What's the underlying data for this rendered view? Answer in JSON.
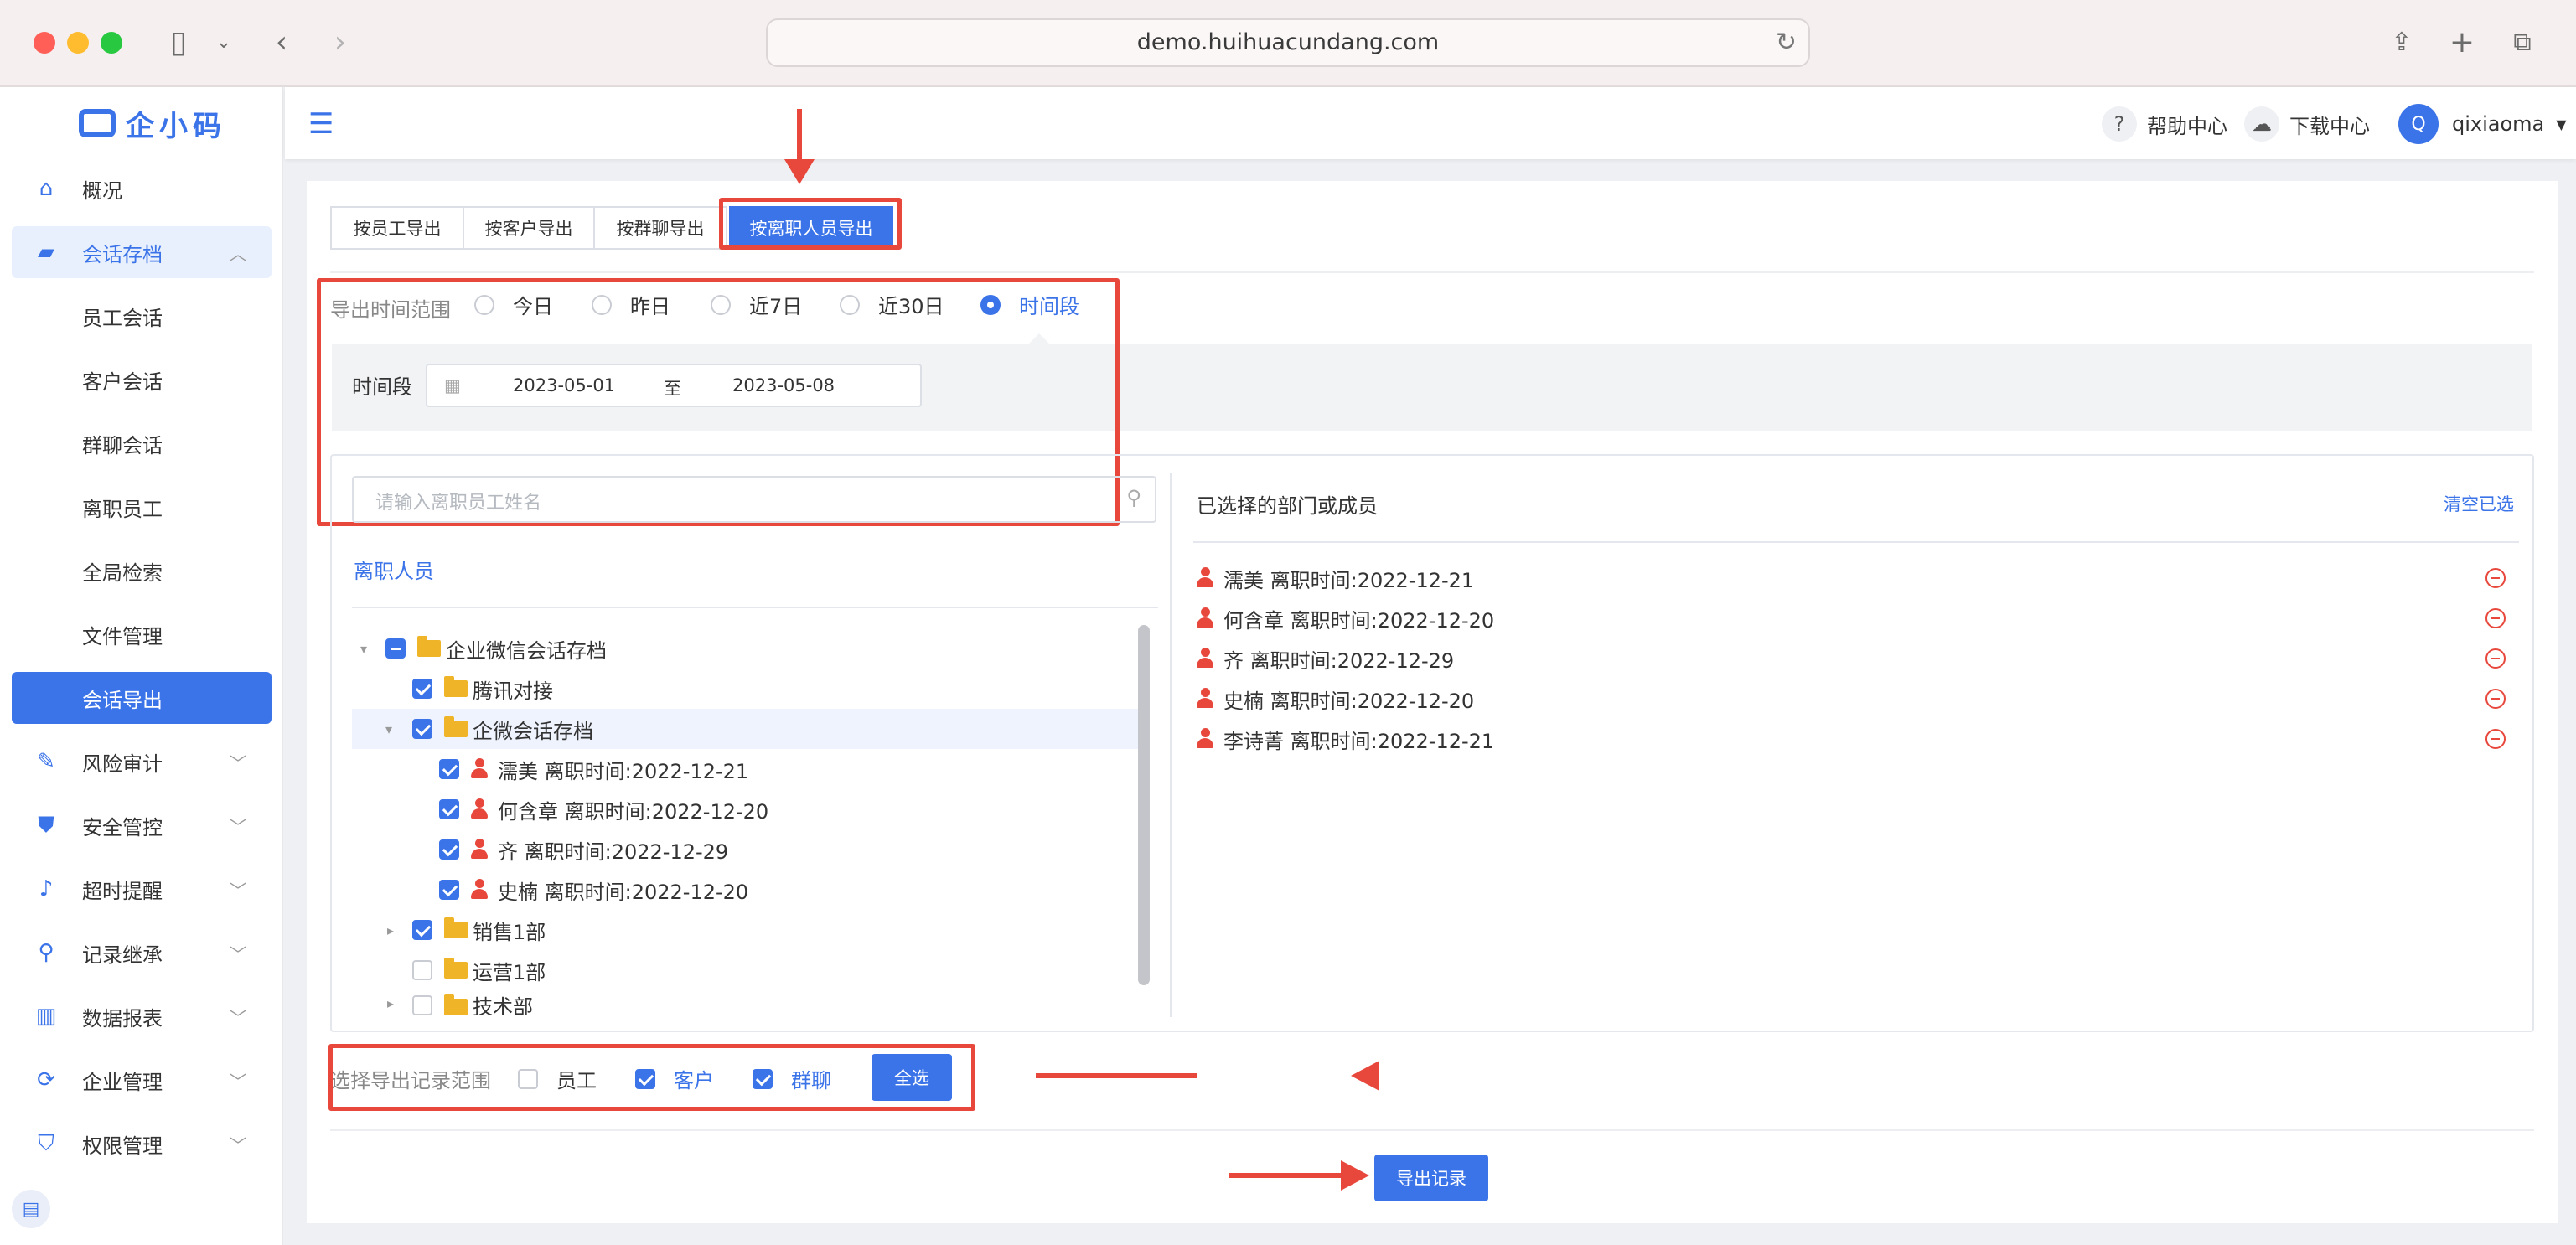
{
  "browser": {
    "url": "demo.huihuacundang.com",
    "colors": {
      "close": "#ff5f57",
      "minimize": "#febc2e",
      "maximize": "#28c840"
    }
  },
  "sidebar": {
    "logo_text": "企小码",
    "items": [
      {
        "label": "概况",
        "icon": "home-icon"
      },
      {
        "label": "会话存档",
        "icon": "folder-icon"
      },
      {
        "label": "员工会话"
      },
      {
        "label": "客户会话"
      },
      {
        "label": "群聊会话"
      },
      {
        "label": "离职员工"
      },
      {
        "label": "全局检索"
      },
      {
        "label": "文件管理"
      },
      {
        "label": "会话导出"
      },
      {
        "label": "风险审计",
        "icon": "edit-icon"
      },
      {
        "label": "安全管控",
        "icon": "shield-icon"
      },
      {
        "label": "超时提醒",
        "icon": "bell-icon"
      },
      {
        "label": "记录继承",
        "icon": "user-search-icon"
      },
      {
        "label": "数据报表",
        "icon": "bar-chart-icon"
      },
      {
        "label": "企业管理",
        "icon": "refresh-icon"
      },
      {
        "label": "权限管理",
        "icon": "shield-lock-icon"
      }
    ]
  },
  "topbar": {
    "help": "帮助中心",
    "download": "下载中心",
    "avatar_letter": "Q",
    "username": "qixiaoma"
  },
  "tabs": [
    "按员工导出",
    "按客户导出",
    "按群聊导出",
    "按离职人员导出"
  ],
  "time_range": {
    "label": "导出时间范围",
    "options": [
      "今日",
      "昨日",
      "近7日",
      "近30日",
      "时间段"
    ],
    "selected": "时间段",
    "period_label": "时间段",
    "start": "2023-05-01",
    "separator": "至",
    "end": "2023-05-08"
  },
  "left_panel": {
    "search_placeholder": "请输入离职员工姓名",
    "title": "离职人员",
    "tree": [
      {
        "label": "企业微信会话存档"
      },
      {
        "label": "腾讯对接"
      },
      {
        "label": "企微会话存档"
      },
      {
        "label": "濡美 离职时间:2022-12-21"
      },
      {
        "label": "何含章 离职时间:2022-12-20"
      },
      {
        "label": "齐 离职时间:2022-12-29"
      },
      {
        "label": "史楠 离职时间:2022-12-20"
      },
      {
        "label": "销售1部"
      },
      {
        "label": "运营1部"
      },
      {
        "label": "技术部"
      }
    ]
  },
  "right_panel": {
    "title": "已选择的部门或成员",
    "clear": "清空已选",
    "selected": [
      "濡美 离职时间:2022-12-21",
      "何含章 离职时间:2022-12-20",
      "齐 离职时间:2022-12-29",
      "史楠 离职时间:2022-12-20",
      "李诗菁 离职时间:2022-12-21"
    ]
  },
  "scope": {
    "label": "选择导出记录范围",
    "options": [
      {
        "label": "员工",
        "checked": false
      },
      {
        "label": "客户",
        "checked": true
      },
      {
        "label": "群聊",
        "checked": true
      }
    ],
    "select_all": "全选"
  },
  "export_button": "导出记录",
  "colors": {
    "primary": "#3b73e8",
    "annotation_red": "#e8473c"
  }
}
